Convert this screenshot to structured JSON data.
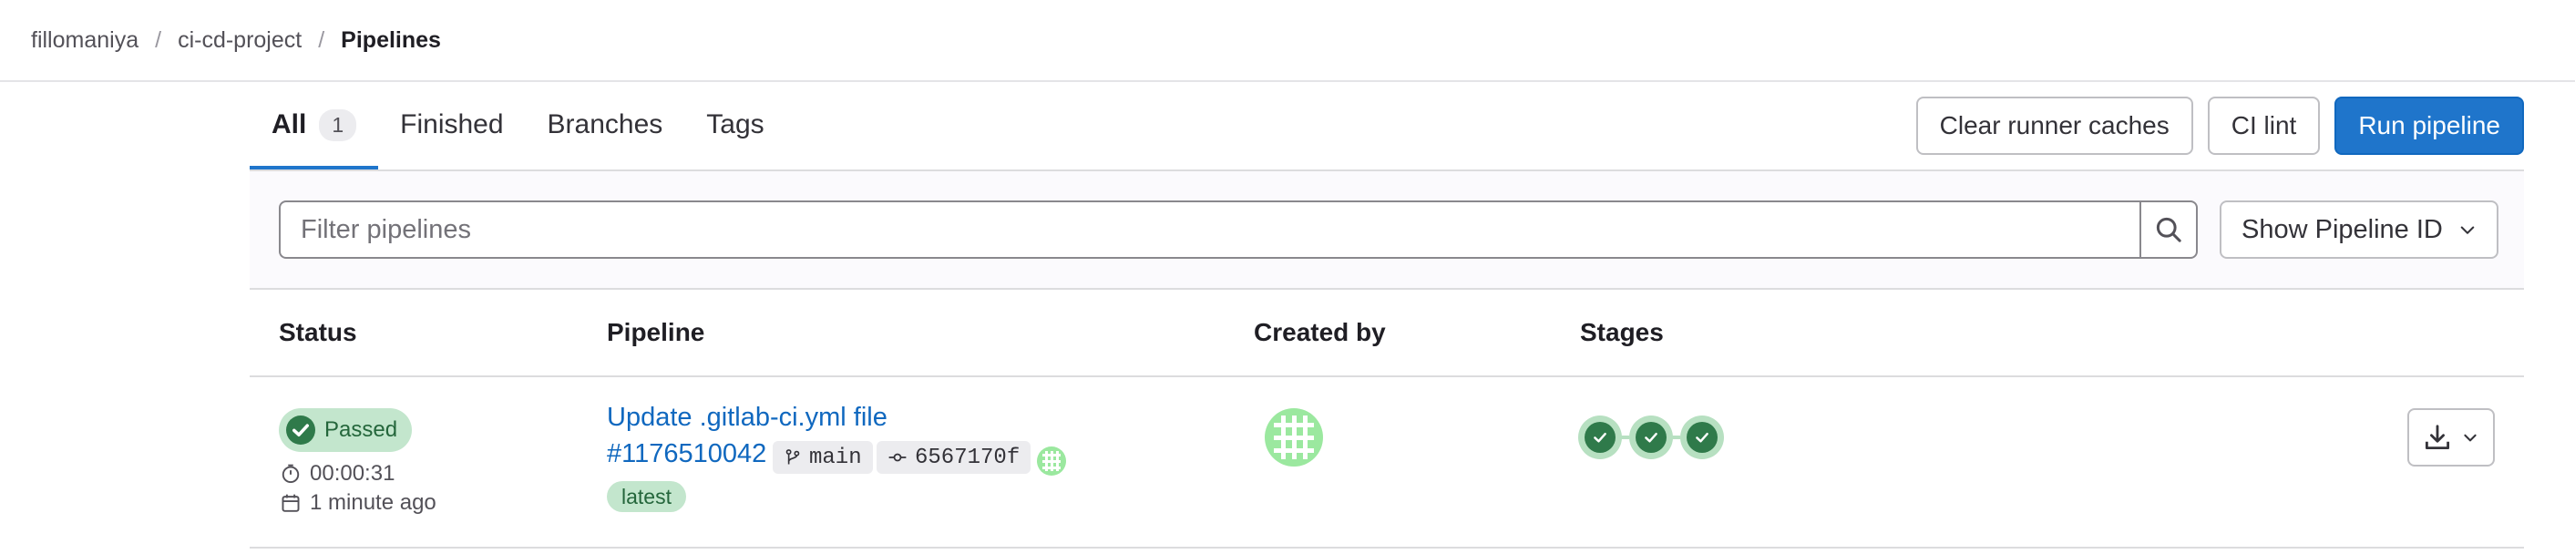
{
  "breadcrumb": {
    "items": [
      "fillomaniya",
      "ci-cd-project"
    ],
    "current": "Pipelines",
    "separator": "/"
  },
  "tabs": [
    {
      "label": "All",
      "count": "1"
    },
    {
      "label": "Finished"
    },
    {
      "label": "Branches"
    },
    {
      "label": "Tags"
    }
  ],
  "actions": {
    "clear_caches": "Clear runner caches",
    "ci_lint": "CI lint",
    "run_pipeline": "Run pipeline"
  },
  "filter": {
    "placeholder": "Filter pipelines",
    "value": "",
    "select_label": "Show Pipeline ID"
  },
  "table": {
    "headers": {
      "status": "Status",
      "pipeline": "Pipeline",
      "created_by": "Created by",
      "stages": "Stages"
    },
    "rows": [
      {
        "status": "Passed",
        "duration": "00:00:31",
        "finished": "1 minute ago",
        "commit_title": "Update .gitlab-ci.yml file",
        "pipeline_id": "#1176510042",
        "branch": "main",
        "commit_sha": "6567170f",
        "tag": "latest",
        "stages": [
          "passed",
          "passed",
          "passed"
        ]
      }
    ]
  },
  "colors": {
    "accent": "#1f75cb",
    "success": "#2f7a4a",
    "success_bg": "#c3e6cd",
    "link": "#1068bf"
  },
  "icons": [
    "search-icon",
    "chevron-down-icon",
    "check-circle-icon",
    "clock-icon",
    "calendar-icon",
    "branch-icon",
    "commit-icon",
    "avatar-identicon",
    "download-icon"
  ]
}
